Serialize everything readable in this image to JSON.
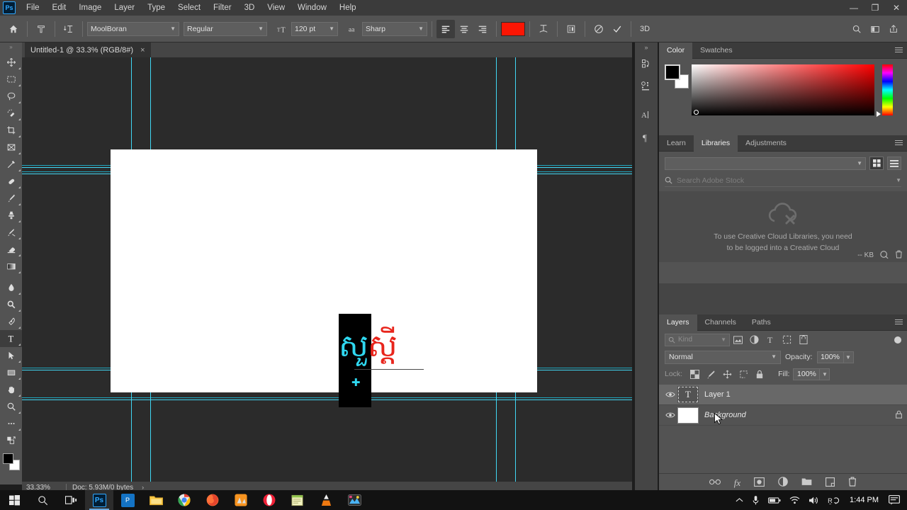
{
  "app": {
    "logo": "Ps",
    "menus": [
      "File",
      "Edit",
      "Image",
      "Layer",
      "Type",
      "Select",
      "Filter",
      "3D",
      "View",
      "Window",
      "Help"
    ],
    "window_controls": {
      "minimize": "minimize-icon",
      "restore": "restore-icon",
      "close": "close-icon"
    }
  },
  "options_bar": {
    "home_icon": "home-icon",
    "tool_icon": "type-tool-icon",
    "orientation_icon": "text-orientation-icon",
    "font_family": "MoolBoran",
    "font_style": "Regular",
    "size_icon": "font-size-icon",
    "font_size": "120 pt",
    "aa_icon": "anti-alias-icon",
    "anti_alias": "Sharp",
    "align": [
      "align-left",
      "align-center",
      "align-right"
    ],
    "align_active": "align-left",
    "text_color": "#fb1604",
    "warp_icon": "warp-text-icon",
    "panels_icon": "character-panel-icon",
    "cancel_icon": "cancel-icon",
    "commit_icon": "commit-icon",
    "threed_label": "3D",
    "right_icons": [
      "search-icon",
      "workspace-icon",
      "share-icon"
    ]
  },
  "toolbar": {
    "tools": [
      {
        "name": "move-tool",
        "glyph": "move"
      },
      {
        "name": "marquee-tool",
        "glyph": "marquee"
      },
      {
        "name": "lasso-tool",
        "glyph": "lasso"
      },
      {
        "name": "quick-selection-tool",
        "glyph": "quickselect"
      },
      {
        "name": "crop-tool",
        "glyph": "crop"
      },
      {
        "name": "frame-tool",
        "glyph": "frame"
      },
      {
        "name": "eyedropper-tool",
        "glyph": "eyedropper"
      },
      {
        "name": "healing-brush-tool",
        "glyph": "healing"
      },
      {
        "name": "brush-tool",
        "glyph": "brush"
      },
      {
        "name": "clone-stamp-tool",
        "glyph": "stamp"
      },
      {
        "name": "history-brush-tool",
        "glyph": "historybrush"
      },
      {
        "name": "eraser-tool",
        "glyph": "eraser"
      },
      {
        "name": "gradient-tool",
        "glyph": "gradient"
      },
      {
        "name": "blur-tool",
        "glyph": "blur"
      },
      {
        "name": "dodge-tool",
        "glyph": "dodge"
      },
      {
        "name": "pen-tool",
        "glyph": "pen"
      },
      {
        "name": "type-tool",
        "glyph": "type",
        "active": true
      },
      {
        "name": "path-selection-tool",
        "glyph": "pathselect"
      },
      {
        "name": "shape-tool",
        "glyph": "rectangle"
      },
      {
        "name": "hand-tool",
        "glyph": "hand"
      },
      {
        "name": "zoom-tool",
        "glyph": "zoom"
      },
      {
        "name": "edit-toolbar",
        "glyph": "ellipsis"
      }
    ],
    "foreground_color": "#000000",
    "background_color": "#ffffff"
  },
  "document": {
    "tab_title": "Untitled-1 @ 33.3% (RGB/8#)",
    "close_label": "×",
    "text_selected": "សួ",
    "text_rest": "ស្ដី",
    "guide_color": "#41d8f5"
  },
  "status_bar": {
    "zoom": "33.33%",
    "doc_info": "Doc: 5.93M/0 bytes",
    "arrow": "›"
  },
  "mini_dock": {
    "items": [
      "history-icon",
      "properties-icon",
      "character-icon",
      "paragraph-icon"
    ]
  },
  "color_panel": {
    "tabs": [
      "Color",
      "Swatches"
    ],
    "active_tab": "Color",
    "foreground": "#000000",
    "background": "#ffffff",
    "ramp_base": "#ff0000"
  },
  "libraries_panel": {
    "tabs": [
      "Learn",
      "Libraries",
      "Adjustments"
    ],
    "active_tab": "Libraries",
    "search_placeholder": "Search Adobe Stock",
    "empty_message_line1": "To use Creative Cloud Libraries, you need",
    "empty_message_line2": "to be logged into a Creative Cloud",
    "size_label": "-- KB",
    "cloud_icon": "cloud-off-icon",
    "delete_icon": "trash-icon"
  },
  "layers_panel": {
    "tabs": [
      "Layers",
      "Channels",
      "Paths"
    ],
    "active_tab": "Layers",
    "filter_placeholder": "Kind",
    "filter_icons": [
      "pixel-filter-icon",
      "adjustment-filter-icon",
      "type-filter-icon",
      "shape-filter-icon",
      "smart-object-filter-icon"
    ],
    "blend_mode": "Normal",
    "opacity_label": "Opacity:",
    "opacity_value": "100%",
    "lock_label": "Lock:",
    "lock_icons": [
      "lock-transparent-icon",
      "lock-image-icon",
      "lock-position-icon",
      "lock-artboard-icon",
      "lock-all-icon"
    ],
    "fill_label": "Fill:",
    "fill_value": "100%",
    "layers": [
      {
        "name": "Layer 1",
        "type": "text",
        "visible": true,
        "selected": true,
        "locked": false
      },
      {
        "name": "Background",
        "type": "background",
        "visible": true,
        "selected": false,
        "locked": true
      }
    ],
    "footer_icons": [
      "link-layers-icon",
      "layer-style-icon",
      "layer-mask-icon",
      "adjustment-layer-icon",
      "new-group-icon",
      "new-layer-icon",
      "delete-layer-icon"
    ],
    "fx_label": "fx"
  },
  "taskbar": {
    "items": [
      "start-icon",
      "search-icon",
      "task-view-icon",
      "photoshop-icon",
      "ps-secondary-icon",
      "file-explorer-icon",
      "chrome-icon",
      "firefox-icon",
      "orange-app-icon",
      "opera-icon",
      "notes-icon",
      "vlc-icon",
      "gallery-icon"
    ],
    "active_item": "photoshop-icon",
    "tray": [
      "chevron-up-icon",
      "microphone-icon",
      "battery-icon",
      "wifi-icon",
      "volume-icon",
      "input-method-icon"
    ],
    "clock": "1:44 PM",
    "notification_icon": "notification-icon"
  }
}
